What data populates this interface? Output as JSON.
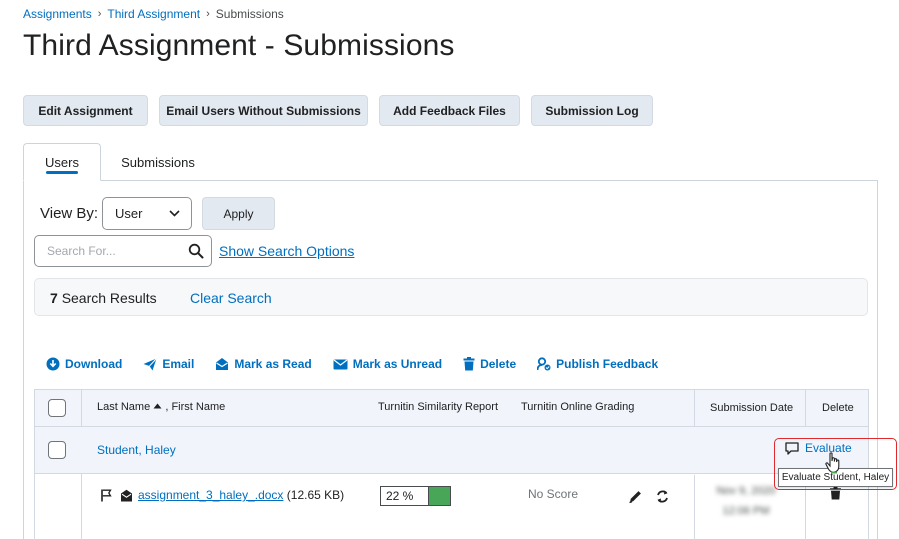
{
  "breadcrumb": {
    "root": "Assignments",
    "parent": "Third Assignment",
    "current": "Submissions",
    "separator": "›"
  },
  "page_title": "Third Assignment - Submissions",
  "actions": {
    "edit": "Edit Assignment",
    "email": "Email Users Without Submissions",
    "feedback": "Add Feedback Files",
    "log": "Submission Log"
  },
  "tabs": {
    "users": "Users",
    "submissions": "Submissions"
  },
  "view_by": {
    "label": "View By:",
    "selected": "User",
    "apply": "Apply"
  },
  "search": {
    "placeholder": "Search For...",
    "show_options": "Show Search Options"
  },
  "results": {
    "count": "7",
    "label": "Search Results",
    "clear": "Clear Search"
  },
  "toolbar": {
    "download": "Download",
    "email": "Email",
    "mark_read": "Mark as Read",
    "mark_unread": "Mark as Unread",
    "delete": "Delete",
    "publish": "Publish Feedback"
  },
  "table": {
    "headers": {
      "name_last": "Last Name",
      "name_first": ", First Name",
      "turnitin_report": "Turnitin Similarity Report",
      "turnitin_grading": "Turnitin Online Grading",
      "submission_date": "Submission Date",
      "delete": "Delete"
    },
    "student": {
      "name": "Student, Haley",
      "evaluate": "Evaluate",
      "tooltip": "Evaluate Student, Haley"
    },
    "file": {
      "name": "assignment_3_haley_.docx",
      "size": "(12.65 KB)",
      "similarity": "22 %",
      "similarity_value": 22,
      "score": "No Score",
      "date_line1": "Nov 9, 2020",
      "date_line2": "12:06 PM"
    }
  },
  "colors": {
    "link": "#006fbf",
    "similarity_bar": "#48a658",
    "highlight": "#e0282d"
  }
}
